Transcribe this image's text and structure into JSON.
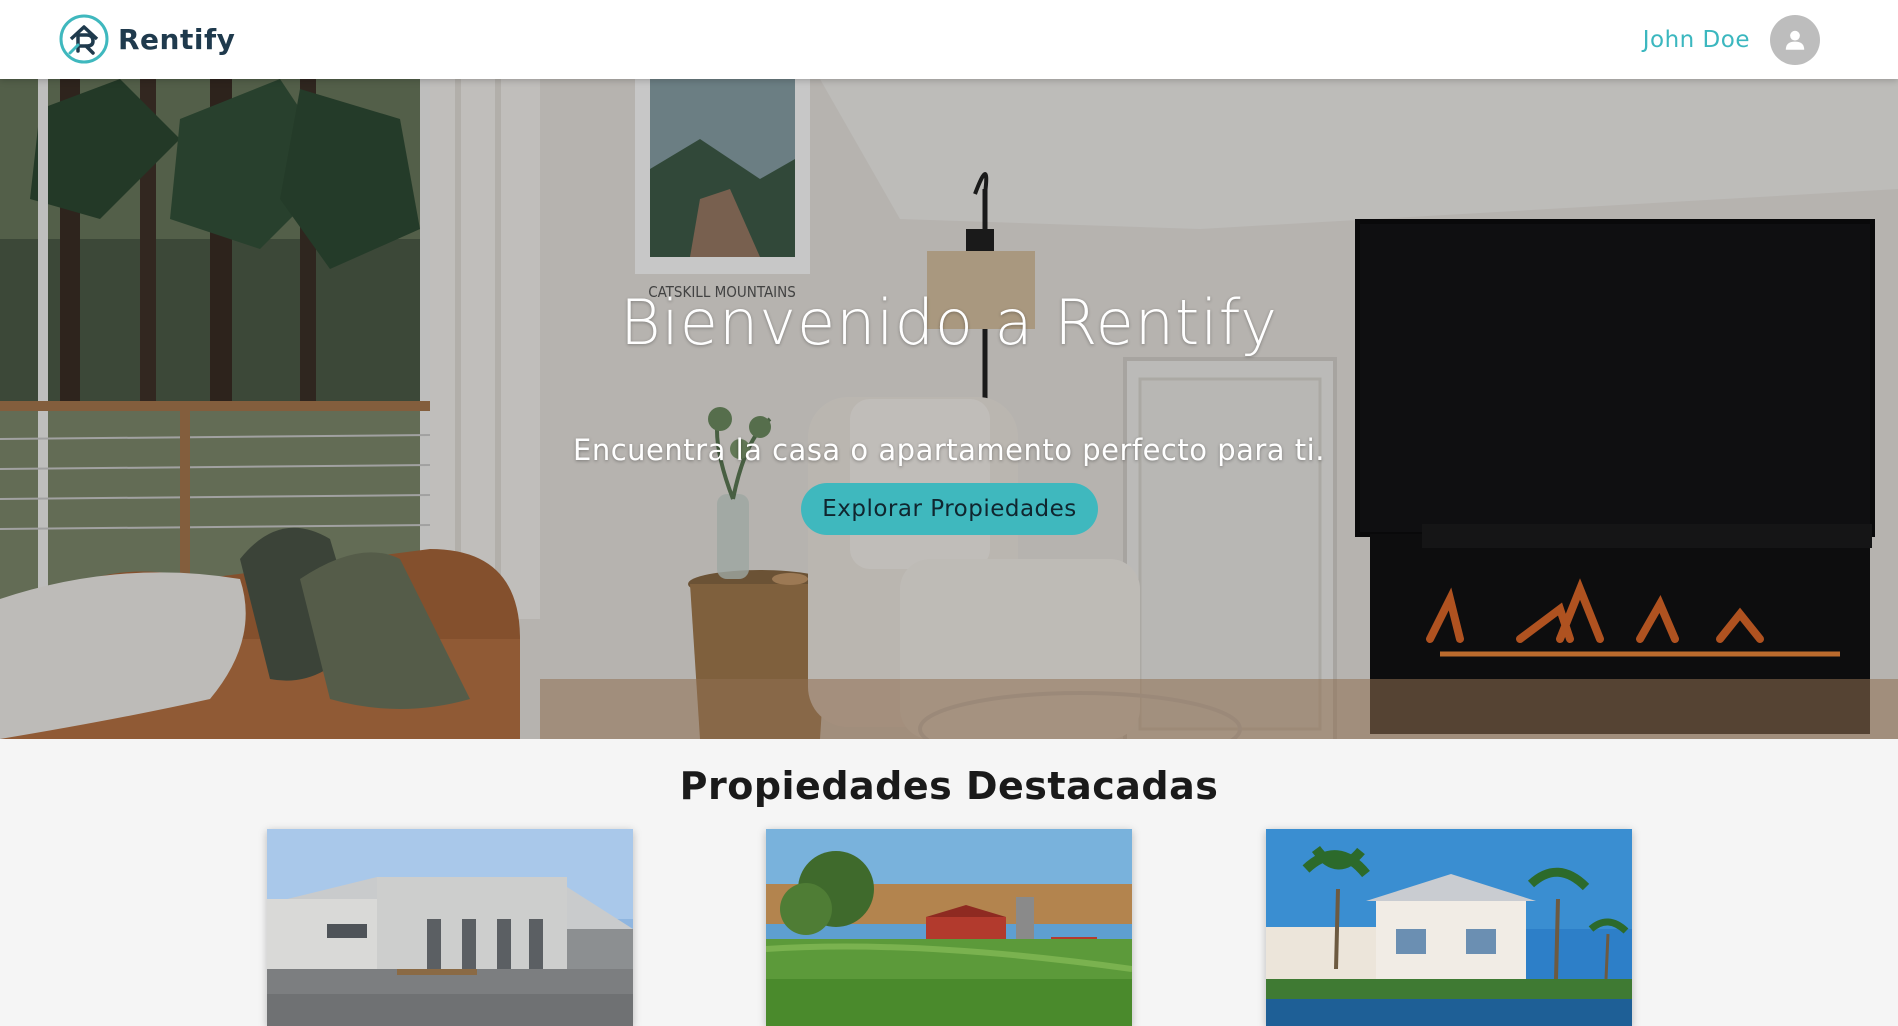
{
  "header": {
    "brand": "Rentify",
    "user_name": "John Doe"
  },
  "hero": {
    "title": "Bienvenido a Rentify",
    "subtitle": "Encuentra la casa o apartamento perfecto para ti.",
    "cta_label": "Explorar Propiedades",
    "poster_text": "CATSKILL MOUNTAINS"
  },
  "featured": {
    "title": "Propiedades Destacadas"
  },
  "colors": {
    "accent": "#3fb8be",
    "brand_dark": "#1f3a4d",
    "user_name": "#3bb7bf"
  }
}
